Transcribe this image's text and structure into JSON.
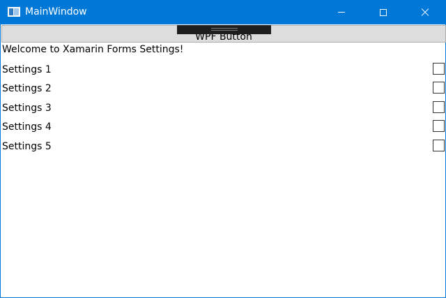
{
  "window": {
    "title": "MainWindow",
    "accent_color": "#0078d7",
    "icons": {
      "app": "window-app-icon",
      "minimize": "minimize-icon",
      "maximize": "maximize-icon",
      "close": "close-icon"
    }
  },
  "content": {
    "wpf_button_label": "WPF Button",
    "welcome_text": "Welcome to Xamarin Forms Settings!",
    "settings": [
      {
        "label": "Settings 1",
        "checked": false
      },
      {
        "label": "Settings 2",
        "checked": false
      },
      {
        "label": "Settings 3",
        "checked": false
      },
      {
        "label": "Settings 4",
        "checked": false
      },
      {
        "label": "Settings 5",
        "checked": false
      }
    ]
  }
}
